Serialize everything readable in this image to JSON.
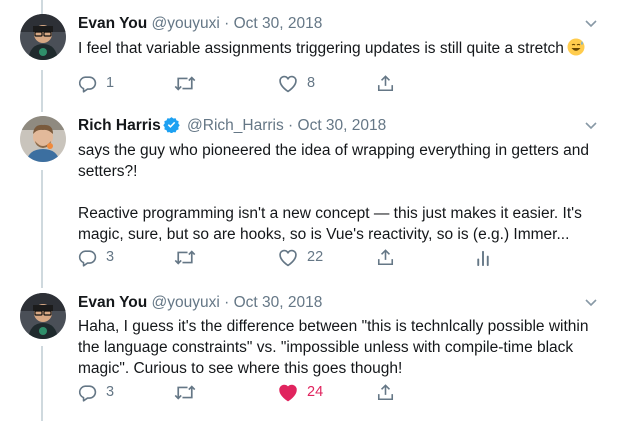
{
  "tweets": [
    {
      "name": "Evan You",
      "handle": "@youyuxi",
      "dot": "·",
      "date": "Oct 30, 2018",
      "verified": false,
      "lines": [
        "I feel that variable assignments triggering updates is still quite a stretch"
      ],
      "emoji": "sweat-smile-emoji",
      "counts": {
        "reply": "1",
        "retweet": "",
        "like": "8"
      },
      "liked": false,
      "analytics": false
    },
    {
      "name": "Rich Harris",
      "handle": "@Rich_Harris",
      "dot": "·",
      "date": "Oct 30, 2018",
      "verified": true,
      "lines": [
        "says the guy who pioneered the idea of wrapping everything in getters and",
        "setters?!",
        "",
        "Reactive programming isn't a new concept — this just makes it easier. It's",
        "magic, sure, but so are hooks, so is Vue's reactivity, so is (e.g.) Immer..."
      ],
      "counts": {
        "reply": "3",
        "retweet": "",
        "like": "22"
      },
      "liked": false,
      "analytics": true
    },
    {
      "name": "Evan You",
      "handle": "@youyuxi",
      "dot": "·",
      "date": "Oct 30, 2018",
      "verified": false,
      "lines": [
        "Haha, I guess it's the difference between \"this is technlcally possible within",
        "the language constraints\" vs. \"impossible unless with compile-time black",
        "magic\". Curious to see where this goes though!"
      ],
      "counts": {
        "reply": "3",
        "retweet": "",
        "like": "24"
      },
      "liked": true,
      "analytics": false
    }
  ],
  "colors": {
    "text": "#14171a",
    "secondary": "#657786",
    "verified": "#1da1f2",
    "like_active": "#e0245e",
    "thread_line": "#cfd9de"
  },
  "icons": [
    "reply-icon",
    "retweet-icon",
    "like-icon",
    "share-icon",
    "analytics-icon",
    "chevron-down-icon",
    "verified-badge-icon"
  ]
}
